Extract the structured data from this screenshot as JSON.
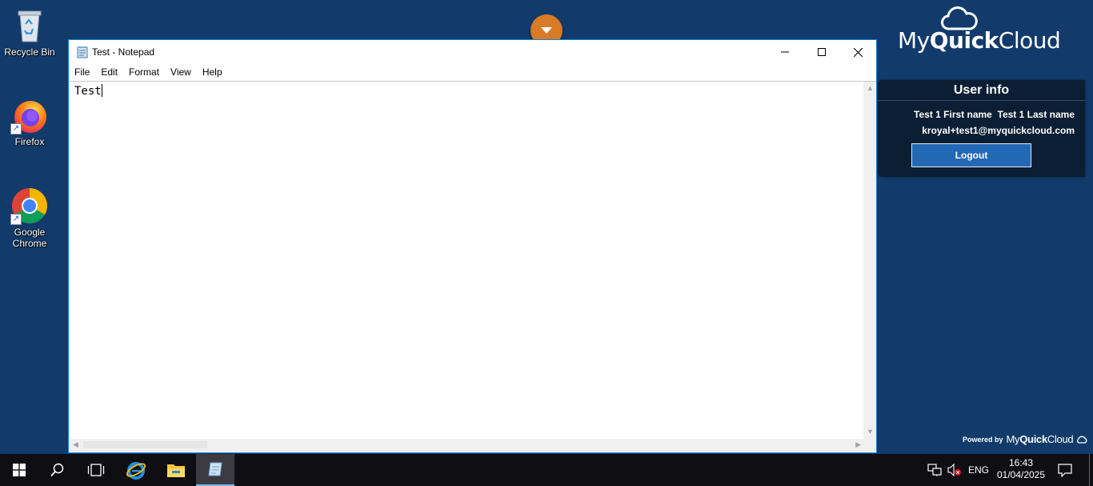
{
  "desktop": {
    "icons": [
      {
        "label": "Recycle Bin",
        "icon": "recycle-bin-icon"
      },
      {
        "label": "Firefox",
        "icon": "firefox-icon"
      },
      {
        "label": "Google\nChrome",
        "label_line1": "Google",
        "label_line2": "Chrome",
        "icon": "chrome-icon"
      }
    ]
  },
  "brand": {
    "prefix": "My",
    "bold": "Quick",
    "suffix": "Cloud"
  },
  "user_info": {
    "title": "User info",
    "name": "Test 1 First name  Test 1 Last name",
    "email": "kroyal+test1@myquickcloud.com",
    "logout_label": "Logout"
  },
  "powered_by": {
    "label": "Powered by",
    "prefix": "My",
    "bold": "Quick",
    "suffix": "Cloud"
  },
  "notepad": {
    "title": "Test - Notepad",
    "menu": [
      "File",
      "Edit",
      "Format",
      "View",
      "Help"
    ],
    "content": "Test"
  },
  "taskbar": {
    "language": "ENG",
    "time": "16:43",
    "date": "01/04/2025"
  },
  "colors": {
    "desktop_bg": "#123b6b",
    "accent_orange": "#d87b26",
    "logout_button": "#2368b5",
    "panel_bg": "#0b1e33",
    "window_border": "#1683d8"
  }
}
